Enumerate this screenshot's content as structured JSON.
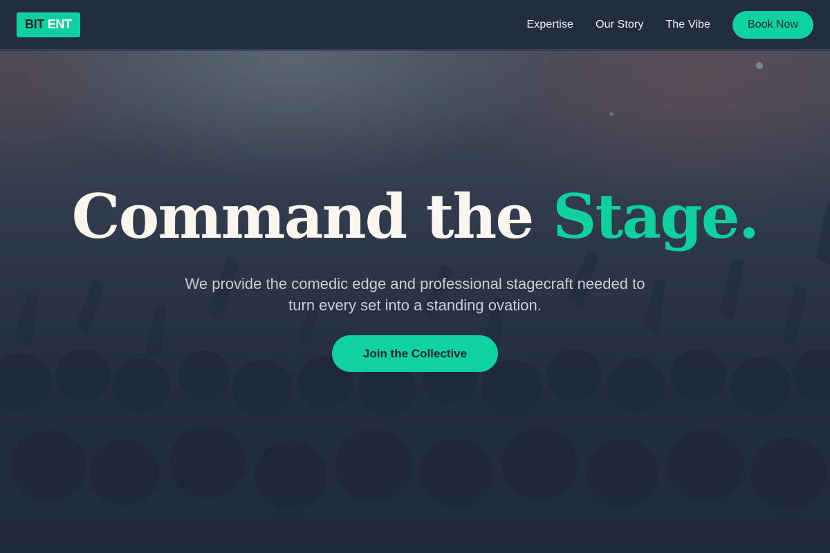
{
  "header": {
    "logo_part1": "BIT",
    "logo_part2": "ENT",
    "nav": [
      {
        "label": "Expertise"
      },
      {
        "label": "Our Story"
      },
      {
        "label": "The Vibe"
      }
    ],
    "cta_label": "Book Now"
  },
  "hero": {
    "title_main": "Command the ",
    "title_accent": "Stage.",
    "subtitle": "We provide the comedic edge and professional stagecraft needed to turn every set into a standing ovation.",
    "cta_label": "Join the Collective",
    "background_image": "concert-crowd-photo"
  },
  "colors": {
    "accent": "#10cfa0",
    "header_bg": "#222d3e",
    "hero_bg": "#1f2a3c",
    "title": "#fbf7ee"
  }
}
